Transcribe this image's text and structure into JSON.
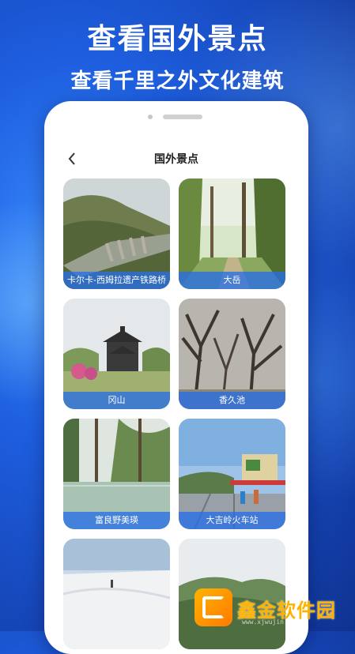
{
  "promo": {
    "headline": "查看国外景点",
    "subheadline": "查看千里之外文化建筑"
  },
  "header": {
    "title": "国外景点",
    "back_icon": "chevron-left-icon"
  },
  "spots": [
    {
      "name": "卡尔卡-西姆拉遗产铁路桥"
    },
    {
      "name": "大岳"
    },
    {
      "name": "冈山"
    },
    {
      "name": "香久池"
    },
    {
      "name": "富良野美瑛"
    },
    {
      "name": "大吉岭火车站"
    },
    {
      "name": ""
    },
    {
      "name": ""
    }
  ],
  "watermark": {
    "text": "鑫金软件园",
    "url": "www.xjwujin.com"
  },
  "colors": {
    "background": "#1e5fe0",
    "label_overlay": "#286ee6"
  }
}
